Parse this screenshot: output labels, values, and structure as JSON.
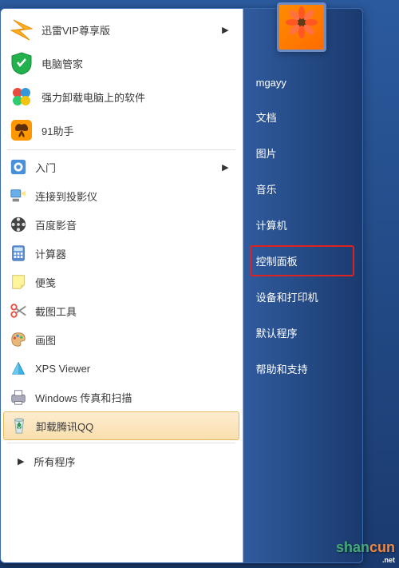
{
  "user": {
    "name": "mgayy"
  },
  "left_items": [
    {
      "id": "xunlei",
      "label": "迅雷VIP尊享版",
      "has_arrow": true
    },
    {
      "id": "pc-manager",
      "label": "电脑管家"
    },
    {
      "id": "uninstall-tool",
      "label": "强力卸载电脑上的软件"
    },
    {
      "id": "91-assistant",
      "label": "91助手"
    }
  ],
  "left_items2": [
    {
      "id": "getting-started",
      "label": "入门",
      "has_arrow": true
    },
    {
      "id": "projector",
      "label": "连接到投影仪"
    },
    {
      "id": "baidu-player",
      "label": "百度影音"
    },
    {
      "id": "calculator",
      "label": "计算器"
    },
    {
      "id": "sticky-notes",
      "label": "便笺"
    },
    {
      "id": "snipping",
      "label": "截图工具"
    },
    {
      "id": "paint",
      "label": "画图"
    },
    {
      "id": "xps",
      "label": "XPS Viewer"
    },
    {
      "id": "fax-scan",
      "label": "Windows 传真和扫描"
    },
    {
      "id": "uninstall-qq",
      "label": "卸载腾讯QQ",
      "selected": true
    }
  ],
  "all_programs_label": "所有程序",
  "right_items": [
    {
      "id": "documents",
      "label": "文档"
    },
    {
      "id": "pictures",
      "label": "图片"
    },
    {
      "id": "music",
      "label": "音乐"
    },
    {
      "id": "computer",
      "label": "计算机"
    },
    {
      "id": "control-panel",
      "label": "控制面板",
      "highlighted": true
    },
    {
      "id": "devices-printers",
      "label": "设备和打印机"
    },
    {
      "id": "default-programs",
      "label": "默认程序"
    },
    {
      "id": "help-support",
      "label": "帮助和支持"
    }
  ],
  "watermark": {
    "part1": "shan",
    "part2": "cun",
    "sub": ".net"
  }
}
